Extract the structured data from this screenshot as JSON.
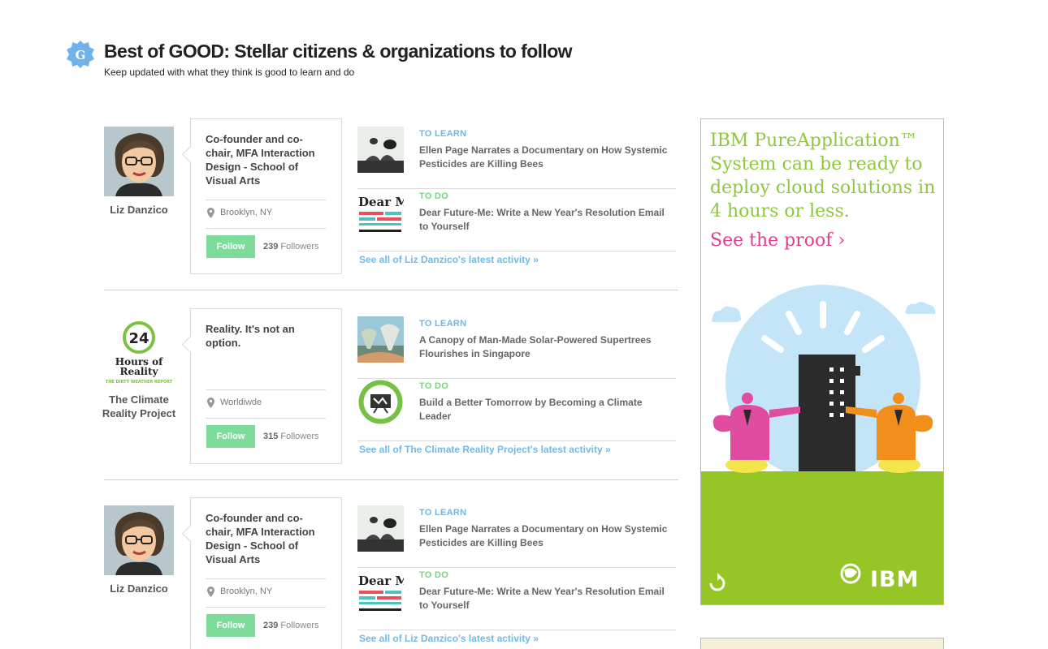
{
  "header": {
    "badge_letter": "G",
    "title": "Best of GOOD: Stellar citizens & organizations to follow",
    "subtitle": "Keep updated with what they think is good to learn and do"
  },
  "entries": [
    {
      "name": "Liz Danzico",
      "bio": "Co-founder and co-chair, MFA Interaction Design - School of Visual Arts",
      "location": "Brooklyn, NY",
      "follow_label": "Follow",
      "followers_count": "239",
      "followers_label": "Followers",
      "activities": [
        {
          "label": "TO LEARN",
          "text": "Ellen Page Narrates a Documentary on How Systemic Pesticides are Killing Bees"
        },
        {
          "label": "TO DO",
          "text": "Dear Future-Me: Write a New Year's Resolution Email to Yourself",
          "thumb_text": "Dear Me"
        }
      ],
      "see_all": "See all of Liz Danzico's latest activity »"
    },
    {
      "name": "The Climate Reality Project",
      "logo_number": "24",
      "logo_title": "Hours of Reality",
      "logo_tagline": "THE DIRTY WEATHER REPORT",
      "bio": "Reality. It's not an option.",
      "location": "Worldiwde",
      "follow_label": "Follow",
      "followers_count": "315",
      "followers_label": "Followers",
      "activities": [
        {
          "label": "TO LEARN",
          "text": "A Canopy of Man-Made Solar-Powered Supertrees Flourishes in Singapore"
        },
        {
          "label": "TO DO",
          "text": "Build a Better Tomorrow by Becoming a Climate Leader"
        }
      ],
      "see_all": "See all of The Climate Reality Project's latest activity »"
    },
    {
      "name": "Liz Danzico",
      "bio": "Co-founder and co-chair, MFA Interaction Design - School of Visual Arts",
      "location": "Brooklyn, NY",
      "follow_label": "Follow",
      "followers_count": "239",
      "followers_label": "Followers",
      "activities": [
        {
          "label": "TO LEARN",
          "text": "Ellen Page Narrates a Documentary on How Systemic Pesticides are Killing Bees"
        },
        {
          "label": "TO DO",
          "text": "Dear Future-Me: Write a New Year's Resolution Email to Yourself",
          "thumb_text": "Dear Me"
        }
      ],
      "see_all": "See all of Liz Danzico's latest activity »"
    }
  ],
  "ad": {
    "headline": "IBM PureApplication™ System can be ready to deploy cloud solutions in 4 hours or less.",
    "cta": "See the proof ›",
    "brand": "IBM"
  },
  "colors": {
    "learn": "#6cb8e3",
    "todo": "#7ad47c",
    "follow_button": "#7ddc9a",
    "link": "#73b9e6",
    "ad_green": "#8fc73e",
    "ad_pink": "#e0408b"
  }
}
